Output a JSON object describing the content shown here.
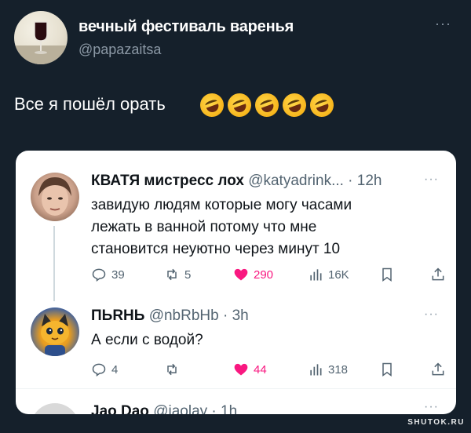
{
  "post": {
    "author_name": "вечный фестиваль варенья",
    "author_handle": "@papazaitsa",
    "more_label": "···",
    "text": "Все я пошёл орать",
    "emoji_icons": [
      "rolling-on-floor-laughing-emoji",
      "rolling-on-floor-laughing-emoji",
      "rolling-on-floor-laughing-emoji",
      "rolling-on-floor-laughing-emoji",
      "rolling-on-floor-laughing-emoji"
    ]
  },
  "quoted": {
    "tweets": [
      {
        "name": "КВАТЯ мистресс лох",
        "meta": "@katyadrink... · 12h",
        "text_lines": [
          "завидую людям которые могу часами",
          "лежать в ванной потому что мне",
          "становится неуютно через минут 10"
        ],
        "replies": "39",
        "retweets": "5",
        "likes": "290",
        "views": "16K"
      },
      {
        "name": "ПЬRНЬ",
        "meta": "@nbRbHb · 3h",
        "text_lines": [
          "А если с водой?"
        ],
        "replies": "4",
        "retweets": "",
        "likes": "44",
        "views": "318"
      },
      {
        "name": "Jao Dao",
        "meta": "@jaolay · 1h"
      }
    ],
    "more_label": "···"
  },
  "colors": {
    "background": "#15202b",
    "card": "#ffffff",
    "like": "#f91880",
    "muted": "#536471"
  },
  "watermark": "SHUTOK.RU"
}
